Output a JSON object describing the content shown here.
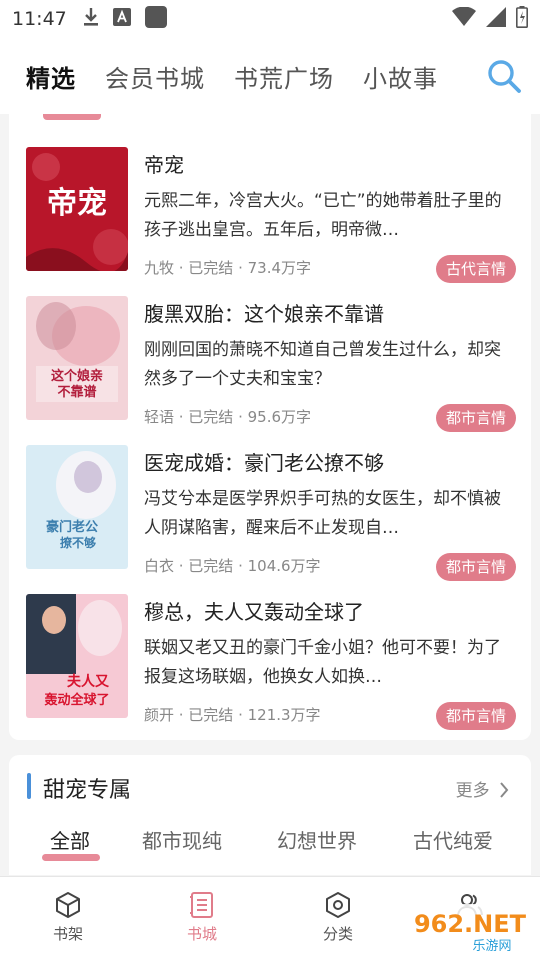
{
  "status_bar": {
    "time": "11:47"
  },
  "top_nav": {
    "tabs": [
      {
        "label": "精选",
        "active": true
      },
      {
        "label": "会员书城",
        "active": false
      },
      {
        "label": "书荒广场",
        "active": false
      },
      {
        "label": "小故事",
        "active": false
      }
    ]
  },
  "books": [
    {
      "title": "帝宠",
      "desc": "元熙二年，冷宫大火。“已亡”的她带着肚子里的孩子逃出皇宫。五年后，明帝微…",
      "meta": "九牧 · 已完结 · 73.4万字",
      "tag": "古代言情",
      "cover_text": "帝宠",
      "cover_color": "#b8162a"
    },
    {
      "title": "腹黑双胎：这个娘亲不靠谱",
      "desc": "刚刚回国的萧晓不知道自己曾发生过什么，却突然多了一个丈夫和宝宝？",
      "meta": "轻语 · 已完结 · 95.6万字",
      "tag": "都市言情",
      "cover_text": "这个娘亲不靠谱",
      "cover_color": "#f3d3d8"
    },
    {
      "title": "医宠成婚：豪门老公撩不够",
      "desc": "冯艾兮本是医学界炽手可热的女医生，却不慎被人阴谋陷害，醒来后不止发现自…",
      "meta": "白衣 · 已完结 · 104.6万字",
      "tag": "都市言情",
      "cover_text": "豪门老公撩不够",
      "cover_color": "#d9ecf5"
    },
    {
      "title": "穆总，夫人又轰动全球了",
      "desc": "联姻又老又丑的豪门千金小姐？他可不要！为了报复这场联姻，他换女人如换…",
      "meta": "颜开 · 已完结 · 121.3万字",
      "tag": "都市言情",
      "cover_text": "夫人又轰动全球了",
      "cover_color": "#f6c9d4"
    }
  ],
  "section": {
    "title": "甜宠专属",
    "more": "更多",
    "tabs": [
      {
        "label": "全部",
        "active": true
      },
      {
        "label": "都市现纯",
        "active": false
      },
      {
        "label": "幻想世界",
        "active": false
      },
      {
        "label": "古代纯爱",
        "active": false
      }
    ]
  },
  "bottom_nav": [
    {
      "label": "书架",
      "icon": "cube-icon",
      "active": false
    },
    {
      "label": "书城",
      "icon": "book-list-icon",
      "active": true
    },
    {
      "label": "分类",
      "icon": "hexagon-icon",
      "active": false
    },
    {
      "label": "",
      "icon": "people-icon",
      "active": false
    }
  ],
  "watermark": {
    "text": "962.NET",
    "subtext": "乐游网"
  },
  "colors": {
    "accent_pink": "#e07c8a",
    "accent_blue": "#4a90d9",
    "search_blue": "#5aa9e6"
  }
}
